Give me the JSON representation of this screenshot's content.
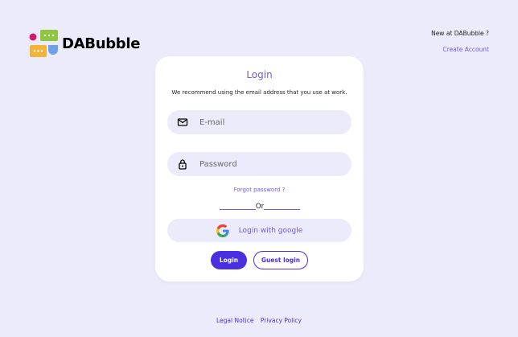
{
  "brand": {
    "name": "DABubble"
  },
  "header": {
    "new_at": "New at DABubble ?",
    "create_account": "Create Account"
  },
  "login_card": {
    "title": "Login",
    "subtitle": "We recommend using the email address that you use at work.",
    "email": {
      "placeholder": "E-mail",
      "value": "",
      "icon": "mail-icon"
    },
    "password": {
      "placeholder": "Password",
      "value": "",
      "icon": "lock-icon"
    },
    "forgot": "Forgot password ?",
    "or_text": "Or",
    "google_label": "Login with google",
    "login_label": "Login",
    "guest_label": "Guest login"
  },
  "footer": {
    "legal": "Legal Notice",
    "privacy": "Privacy Policy"
  },
  "colors": {
    "background": "#ECEBFC",
    "accent": "#6B5BE6",
    "primary_button": "#4A2FE0",
    "card": "#FFFFFF"
  }
}
